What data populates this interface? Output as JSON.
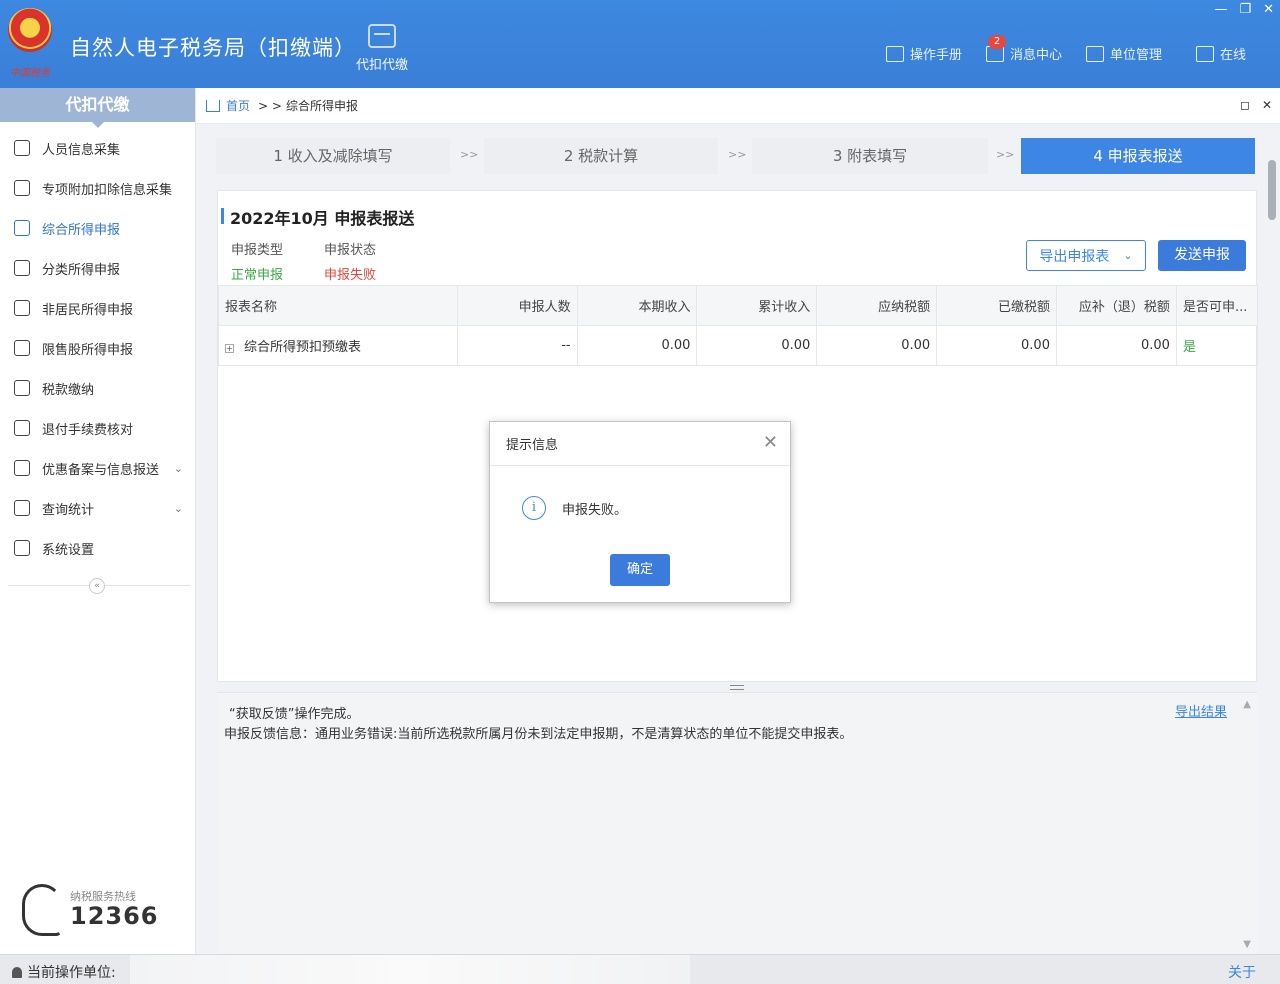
{
  "header": {
    "app_title": "自然人电子税务局（扣缴端）",
    "logo_seal_text": "中国税务",
    "nav_module_label": "代扣代缴",
    "manual_label": "操作手册",
    "message_label": "消息中心",
    "message_badge": "2",
    "unit_label": "单位管理",
    "online_label": "在线",
    "icons": [
      "manual-icon",
      "message-icon",
      "unit-icon",
      "online-icon"
    ]
  },
  "sidebar": {
    "title": "代扣代缴",
    "items": [
      {
        "label": "人员信息采集",
        "icon": "person-icon"
      },
      {
        "label": "专项附加扣除信息采集",
        "icon": "list-icon"
      },
      {
        "label": "综合所得申报",
        "icon": "layers-icon",
        "active": true
      },
      {
        "label": "分类所得申报",
        "icon": "pie-icon"
      },
      {
        "label": "非居民所得申报",
        "icon": "user-icon"
      },
      {
        "label": "限售股所得申报",
        "icon": "bar-chart-icon"
      },
      {
        "label": "税款缴纳",
        "icon": "folder-icon"
      },
      {
        "label": "退付手续费核对",
        "icon": "document-icon"
      },
      {
        "label": "优惠备案与信息报送",
        "icon": "copy-icon",
        "expandable": true
      },
      {
        "label": "查询统计",
        "icon": "search-list-icon",
        "expandable": true
      },
      {
        "label": "系统设置",
        "icon": "gear-icon"
      }
    ],
    "hotline_label": "纳税服务热线",
    "hotline_number": "12366"
  },
  "breadcrumb": {
    "home": "首页",
    "separator": "> >",
    "current": "综合所得申报"
  },
  "steps": [
    {
      "label": "1 收入及减除填写",
      "active": false
    },
    {
      "label": "2 税款计算",
      "active": false
    },
    {
      "label": "3 附表填写",
      "active": false
    },
    {
      "label": "4 申报表报送",
      "active": true
    }
  ],
  "step_separator": ">>",
  "panel": {
    "title": "2022年10月  申报表报送",
    "type_label": "申报类型",
    "type_value": "正常申报",
    "status_label": "申报状态",
    "status_value": "申报失败",
    "export_button": "导出申报表",
    "send_button": "发送申报"
  },
  "table": {
    "columns": [
      "报表名称",
      "申报人数",
      "本期收入",
      "累计收入",
      "应纳税额",
      "已缴税额",
      "应补（退）税额",
      "是否可申..."
    ],
    "rows": [
      [
        "综合所得预扣预缴表",
        "--",
        "0.00",
        "0.00",
        "0.00",
        "0.00",
        "0.00",
        "是"
      ]
    ]
  },
  "dialog": {
    "title": "提示信息",
    "message": "申报失败。",
    "ok_button": "确定"
  },
  "result": {
    "line1": "“获取反馈”操作完成。",
    "line2": "申报反馈信息：通用业务错误:当前所选税款所属月份未到法定申报期，不是清算状态的单位不能提交申报表。",
    "export_link": "导出结果"
  },
  "statusbar": {
    "label": "当前操作单位:",
    "about": "关于"
  },
  "colors": {
    "header_blue": "#3d88e0",
    "accent": "#3d86e3",
    "success_green": "#39a845",
    "error_red": "#e0483d"
  }
}
